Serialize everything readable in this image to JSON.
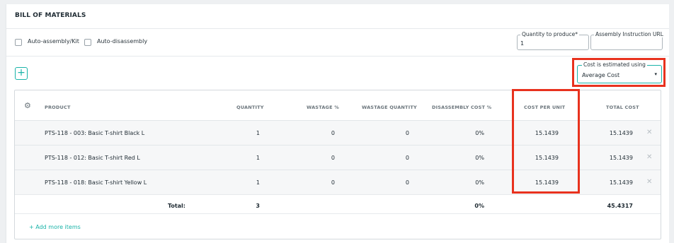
{
  "section_title": "BILL OF MATERIALS",
  "options": {
    "auto_assembly_label": "Auto-assembly/Kit",
    "auto_disassembly_label": "Auto-disassembly"
  },
  "fields": {
    "quantity_label": "Quantity to produce*",
    "quantity_value": "1",
    "instruction_url_label": "Assembly Instruction URL",
    "instruction_url_value": ""
  },
  "cost_estimate": {
    "label": "Cost is estimated using",
    "value": "Average Cost"
  },
  "add_button": "+",
  "columns": {
    "product": "PRODUCT",
    "quantity": "QUANTITY",
    "wastage_pct": "WASTAGE %",
    "wastage_qty": "WASTAGE QUANTITY",
    "disassembly_cost": "DISASSEMBLY COST %",
    "cost_per_unit": "COST PER UNIT",
    "total_cost": "TOTAL COST"
  },
  "rows": [
    {
      "product": "PTS-118 - 003: Basic T-shirt Black L",
      "quantity": "1",
      "wastage_pct": "0",
      "wastage_qty": "0",
      "disassembly_cost": "0%",
      "cost_per_unit": "15.1439",
      "total_cost": "15.1439"
    },
    {
      "product": "PTS-118 - 012: Basic T-shirt Red L",
      "quantity": "1",
      "wastage_pct": "0",
      "wastage_qty": "0",
      "disassembly_cost": "0%",
      "cost_per_unit": "15.1439",
      "total_cost": "15.1439"
    },
    {
      "product": "PTS-118 - 018: Basic T-shirt Yellow L",
      "quantity": "1",
      "wastage_pct": "0",
      "wastage_qty": "0",
      "disassembly_cost": "0%",
      "cost_per_unit": "15.1439",
      "total_cost": "15.1439"
    }
  ],
  "totals": {
    "label": "Total:",
    "quantity": "3",
    "disassembly_cost": "0%",
    "total_cost": "45.4317"
  },
  "add_more_label": "+ Add more items",
  "icons": {
    "settings": "gear-icon",
    "remove": "close-icon",
    "dropdown": "chevron-down-icon"
  },
  "colors": {
    "accent": "#19b3a8",
    "highlight": "#e8321e"
  }
}
